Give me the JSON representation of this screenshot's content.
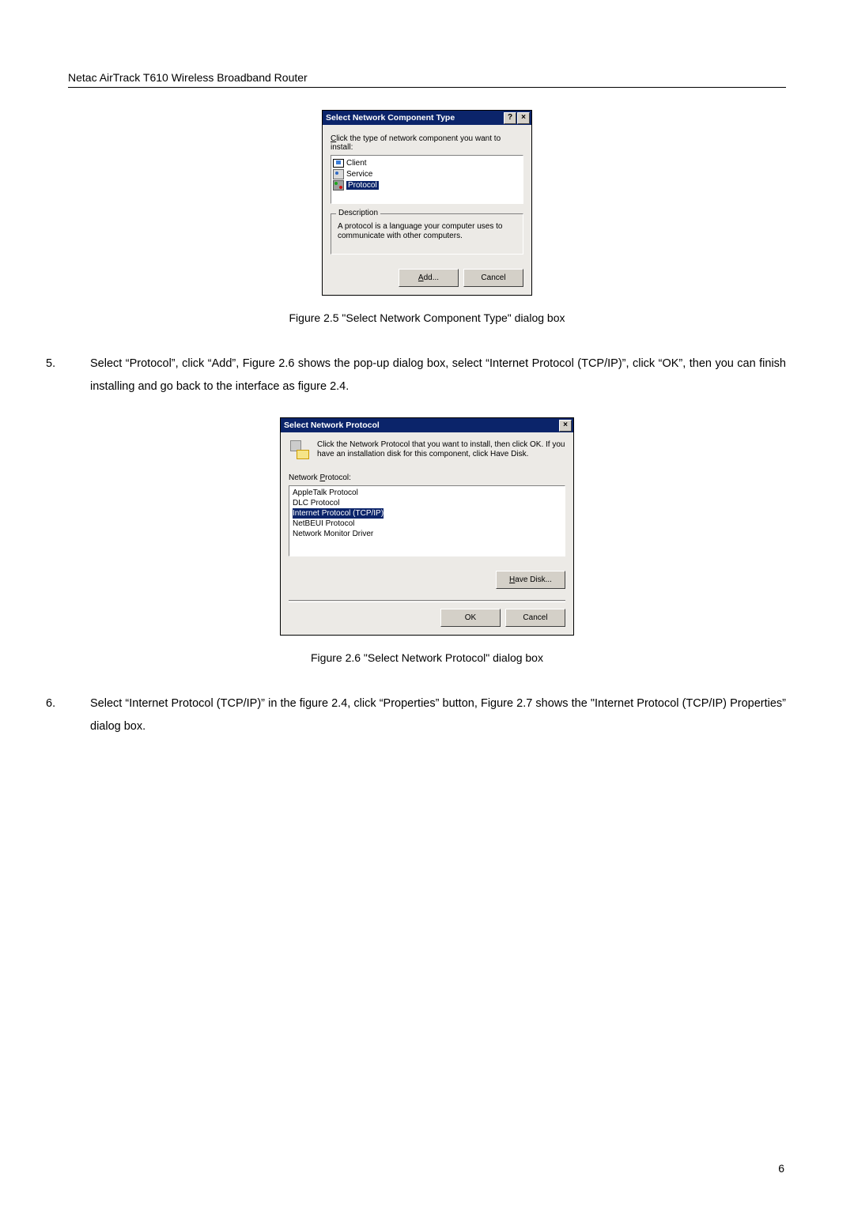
{
  "header": "Netac AirTrack T610 Wireless Broadband Router",
  "dialog1": {
    "title": "Select Network Component Type",
    "help_btn": "?",
    "close_btn": "×",
    "instruction_pre": "C",
    "instruction_rest": "lick the type of network component you want to install:",
    "items": {
      "client": "Client",
      "service": "Service",
      "protocol": "Protocol"
    },
    "group_legend": "Description",
    "description": "A protocol is a language your computer uses to communicate with other computers.",
    "add_u": "A",
    "add_rest": "dd...",
    "cancel": "Cancel"
  },
  "caption1": "Figure 2.5 \"Select Network Component Type\" dialog box",
  "step5": {
    "num": "5.",
    "text": "Select “Protocol”, click “Add”, Figure 2.6 shows the pop-up dialog box, select “Internet Protocol (TCP/IP)”, click “OK”, then you can finish installing and go back to the interface as figure 2.4."
  },
  "dialog2": {
    "title": "Select Network Protocol",
    "close_btn": "×",
    "instruction": "Click the Network Protocol that you want to install, then click OK. If you have an installation disk for this component, click Have Disk.",
    "list_label_u": "P",
    "list_label_pre": "Network ",
    "list_label_post": "rotocol:",
    "items": [
      "AppleTalk Protocol",
      "DLC Protocol",
      "Internet Protocol (TCP/IP)",
      "NetBEUI Protocol",
      "Network Monitor Driver"
    ],
    "have_u": "H",
    "have_rest": "ave Disk...",
    "ok": "OK",
    "cancel": "Cancel"
  },
  "caption2": "Figure 2.6 \"Select Network Protocol\" dialog box",
  "step6": {
    "num": "6.",
    "text": "Select “Internet Protocol (TCP/IP)” in the figure 2.4, click “Properties” button, Figure 2.7 shows the \"Internet Protocol (TCP/IP) Properties” dialog box."
  },
  "page_number": "6"
}
